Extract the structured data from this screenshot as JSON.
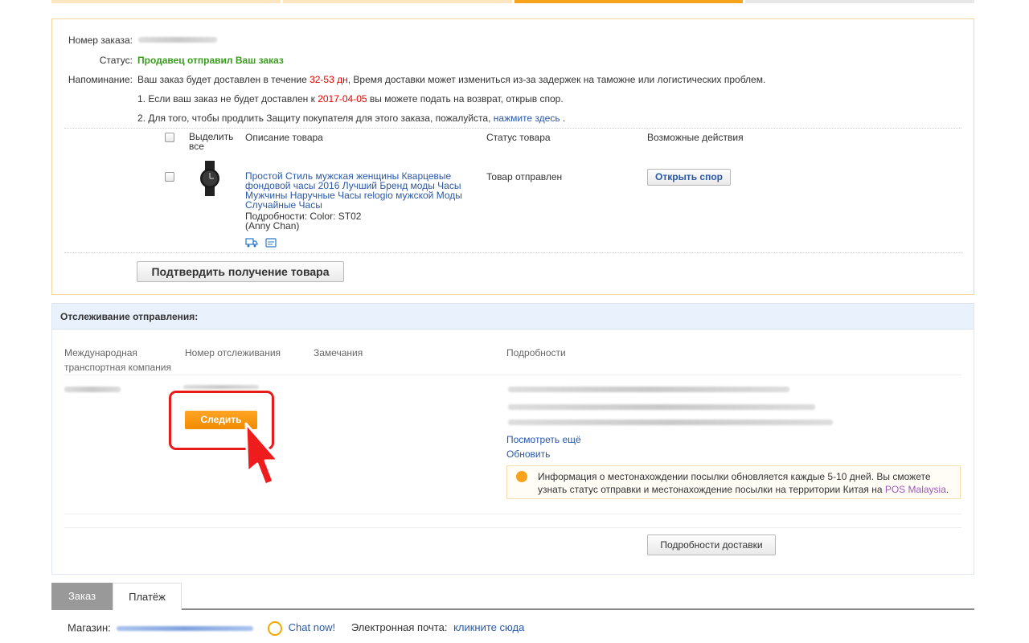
{
  "progress": {
    "colors": [
      "#fce6c2",
      "#fce6c2",
      "#f7a21b",
      "#e8e8e8"
    ]
  },
  "order": {
    "number_label": "Номер заказа:",
    "status_label": "Статус:",
    "status_value": "Продавец отправил Ваш заказ",
    "reminder_label": "Напоминание:",
    "reminder_text_1": "Ваш заказ будет доставлен в течение ",
    "reminder_days": "32-53 дн",
    "reminder_text_2": ", Время доставки может измениться из-за задержек на таможне или логистических проблем.",
    "note1_text_1": "1. Если ваш заказ не будет доставлен к ",
    "note1_date": "2017-04-05",
    "note1_text_2": " вы можете подать на возврат, открыв спор.",
    "note2_text": "2. Для того, чтобы продлить Защиту покупателя для этого заказа, пожалуйста, ",
    "note2_link": "нажмите здесь",
    "note2_end": " .",
    "table_headers": {
      "select_all": "Выделить все",
      "description": "Описание товара",
      "status": "Статус товара",
      "actions": "Возможные действия"
    },
    "item": {
      "title": "Простой Стиль мужская женщины Кварцевые фондовой часы 2016 Лучший Бренд моды Часы Мужчины Наручные Часы relogio мужской Моды Случайные Часы",
      "details": "Подробности: Color: ST02",
      "seller": "(Anny Chan)",
      "status": "Товар отправлен",
      "dispute_button": "Открыть спор"
    },
    "confirm_button": "Подтвердить получение товара"
  },
  "tracking": {
    "header": "Отслеживание отправления:",
    "columns": {
      "company": "Международная транспортная компания",
      "tracking_number": "Номер отслеживания",
      "remarks": "Замечания",
      "details": "Подробности"
    },
    "follow_button": "Следить",
    "see_more": "Посмотреть ещё",
    "refresh": "Обновить",
    "info_text": "Информация о местонахождении посылки обновляется каждые 5-10 дней. Вы сможете узнать статус отправки и местонахождение посылки на территории Китая на ",
    "info_link": "POS Malaysia",
    "info_end": ".",
    "delivery_details_button": "Подробности доставки"
  },
  "tabs": [
    {
      "label": "Заказ",
      "active": true
    },
    {
      "label": "Платёж",
      "active": false
    }
  ],
  "store": {
    "label": "Магазин:",
    "chat": "Chat now!",
    "email_label": "Электронная почта:",
    "email_link": "кликните сюда"
  },
  "colors": {
    "accent_orange": "#f7a21b",
    "link_blue": "#2a59a8",
    "status_green": "#3a9c1e",
    "highlight_red": "#e81a1a"
  }
}
